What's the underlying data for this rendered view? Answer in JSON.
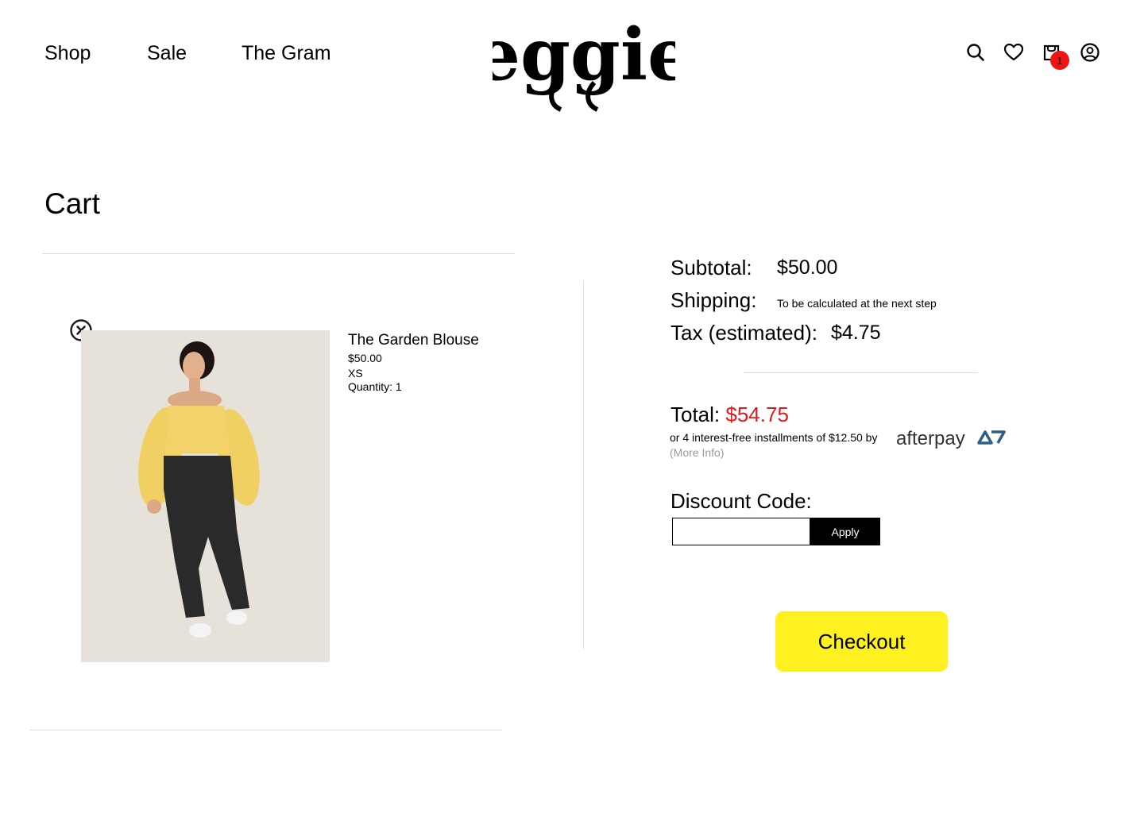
{
  "nav": {
    "shop": "Shop",
    "sale": "Sale",
    "gram": "The Gram"
  },
  "brand": {
    "logo_text": "eggie"
  },
  "header": {
    "cart_count": "1",
    "badge_color": "#f21313"
  },
  "page": {
    "title": "Cart"
  },
  "cart_item": {
    "name": "The Garden Blouse",
    "price": "$50.00",
    "size": "XS",
    "quantity": "Quantity: 1"
  },
  "summary": {
    "subtotal_label": "Subtotal:",
    "subtotal_value": "$50.00",
    "shipping_label": "Shipping:",
    "shipping_value": "To be calculated at the next step",
    "tax_label": "Tax (estimated):",
    "tax_value": "$4.75",
    "total_label": "Total:",
    "total_value": "$54.75",
    "installments": "or 4 interest-free installments of $12.50 by",
    "afterpay_logo": "afterpay",
    "more_info": "(More Info)",
    "total_color": "#e81818"
  },
  "discount": {
    "label": "Discount Code:",
    "value": "",
    "apply": "Apply"
  },
  "checkout": {
    "label": "Checkout",
    "color": "#fff01f"
  }
}
